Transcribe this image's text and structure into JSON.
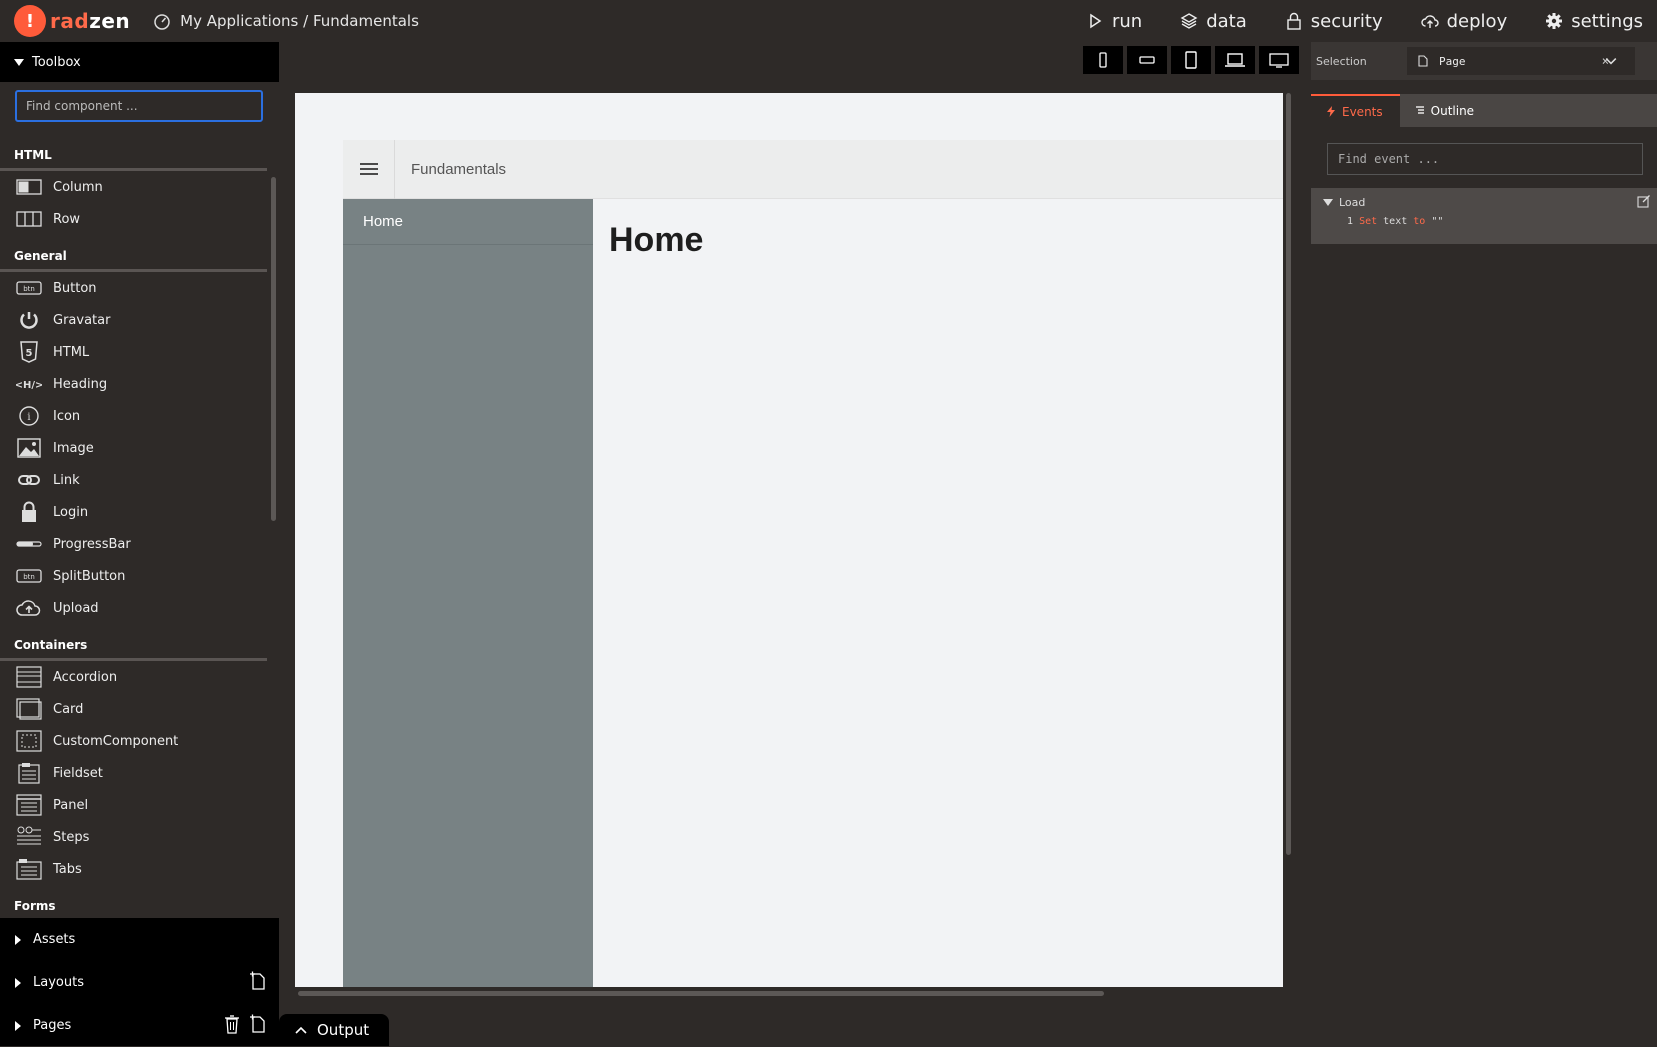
{
  "app": {
    "brand_mark": "!",
    "brand_part1": "rad",
    "brand_part2": "zen",
    "breadcrumb": "My Applications / Fundamentals"
  },
  "topnav": [
    {
      "label": "run",
      "icon": "play-icon"
    },
    {
      "label": "data",
      "icon": "layers-icon"
    },
    {
      "label": "security",
      "icon": "lock-icon"
    },
    {
      "label": "deploy",
      "icon": "cloud-upload-icon"
    },
    {
      "label": "settings",
      "icon": "gear-icon"
    }
  ],
  "toolbox": {
    "title": "Toolbox",
    "search_placeholder": "Find component ...",
    "sections": [
      {
        "name": "HTML",
        "items": [
          "Column",
          "Row"
        ]
      },
      {
        "name": "General",
        "items": [
          "Button",
          "Gravatar",
          "HTML",
          "Heading",
          "Icon",
          "Image",
          "Link",
          "Login",
          "ProgressBar",
          "SplitButton",
          "Upload"
        ]
      },
      {
        "name": "Containers",
        "items": [
          "Accordion",
          "Card",
          "CustomComponent",
          "Fieldset",
          "Panel",
          "Steps",
          "Tabs"
        ]
      },
      {
        "name": "Forms",
        "items": []
      }
    ]
  },
  "bottom_panels": {
    "assets": "Assets",
    "layouts": "Layouts",
    "pages": "Pages"
  },
  "output": {
    "label": "Output"
  },
  "canvas": {
    "app_title": "Fundamentals",
    "side_item": "Home",
    "heading": "Home"
  },
  "right_panel": {
    "selection_label": "Selection",
    "selection_value": "Page",
    "selection_clear": "×",
    "tab_events": "Events",
    "tab_outline": "Outline",
    "event_search_placeholder": "Find event ...",
    "event_name": "Load",
    "action_index": "1",
    "action_kw1": "Set",
    "action_target": "text",
    "action_kw2": "to",
    "action_value": "\"\""
  },
  "colors": {
    "accent": "#ff5b3a",
    "focus": "#2b6fe0",
    "sidebar_app": "#788284"
  }
}
